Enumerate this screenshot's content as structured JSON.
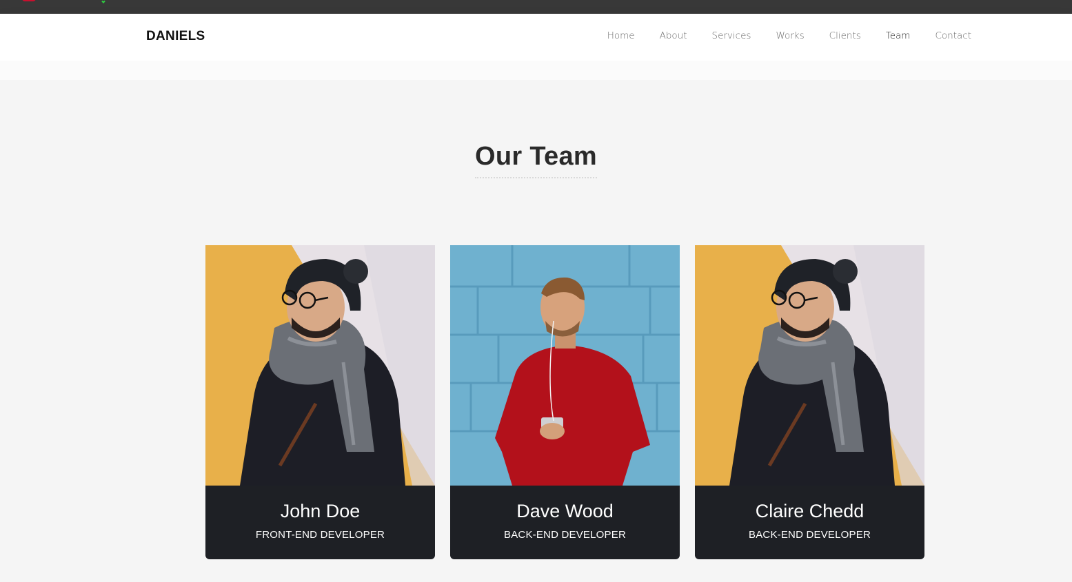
{
  "brand": {
    "logo": "DANIELS"
  },
  "nav": {
    "items": [
      {
        "label": "Home",
        "active": false
      },
      {
        "label": "About",
        "active": false
      },
      {
        "label": "Services",
        "active": false
      },
      {
        "label": "Works",
        "active": false
      },
      {
        "label": "Clients",
        "active": false
      },
      {
        "label": "Team",
        "active": true
      },
      {
        "label": "Contact",
        "active": false
      }
    ]
  },
  "section": {
    "title": "Our Team"
  },
  "team": [
    {
      "name": "John Doe",
      "role": "FRONT-END DEVELOPER",
      "photo": "man-beanie-scarf-photo"
    },
    {
      "name": "Dave Wood",
      "role": "BACK-END DEVELOPER",
      "photo": "man-red-sweater-photo"
    },
    {
      "name": "Claire Chedd",
      "role": "BACK-END DEVELOPER",
      "photo": "man-beanie-scarf-photo"
    }
  ],
  "colors": {
    "card_footer": "#1e2025",
    "page_background": "#f5f5f5",
    "topbar": "#383838"
  }
}
